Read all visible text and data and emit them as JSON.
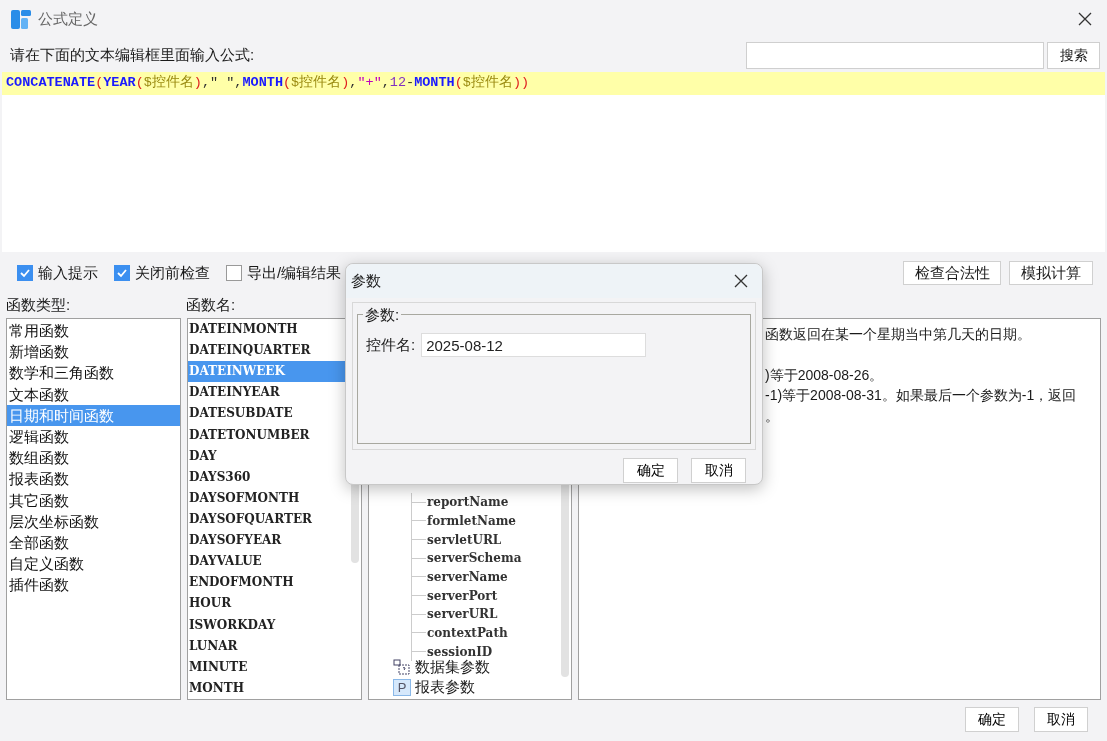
{
  "window": {
    "title": "公式定义"
  },
  "prompt": "请在下面的文本编辑框里面输入公式:",
  "search": {
    "button": "搜索"
  },
  "formula": [
    {
      "kind": "fn",
      "text": "CONCATENATE"
    },
    {
      "kind": "paren",
      "text": "("
    },
    {
      "kind": "fn",
      "text": "YEAR"
    },
    {
      "kind": "paren",
      "text": "("
    },
    {
      "kind": "param",
      "text": "$控件名"
    },
    {
      "kind": "paren",
      "text": ")"
    },
    {
      "kind": "plain",
      "text": ",\" \","
    },
    {
      "kind": "fn",
      "text": "MONTH"
    },
    {
      "kind": "paren",
      "text": "("
    },
    {
      "kind": "param",
      "text": "$控件名"
    },
    {
      "kind": "paren",
      "text": ")"
    },
    {
      "kind": "plain",
      "text": ","
    },
    {
      "kind": "string",
      "text": "\"+\""
    },
    {
      "kind": "plain",
      "text": ","
    },
    {
      "kind": "number",
      "text": "12"
    },
    {
      "kind": "plain",
      "text": "-"
    },
    {
      "kind": "fn",
      "text": "MONTH"
    },
    {
      "kind": "paren",
      "text": "("
    },
    {
      "kind": "param",
      "text": "$控件名"
    },
    {
      "kind": "paren",
      "text": "))"
    }
  ],
  "options": [
    {
      "label": "输入提示",
      "checked": true
    },
    {
      "label": "关闭前检查",
      "checked": true
    },
    {
      "label": "导出/编辑结果",
      "checked": false
    }
  ],
  "actions": [
    "检查合法性",
    "模拟计算"
  ],
  "types_label": "函数类型:",
  "types": [
    {
      "label": "常用函数",
      "selected": false
    },
    {
      "label": "新增函数",
      "selected": false
    },
    {
      "label": "数学和三角函数",
      "selected": false
    },
    {
      "label": "文本函数",
      "selected": false
    },
    {
      "label": "日期和时间函数",
      "selected": true
    },
    {
      "label": "逻辑函数",
      "selected": false
    },
    {
      "label": "数组函数",
      "selected": false
    },
    {
      "label": "报表函数",
      "selected": false
    },
    {
      "label": "其它函数",
      "selected": false
    },
    {
      "label": "层次坐标函数",
      "selected": false
    },
    {
      "label": "全部函数",
      "selected": false
    },
    {
      "label": "自定义函数",
      "selected": false
    },
    {
      "label": "插件函数",
      "selected": false
    }
  ],
  "names_label": "函数名:",
  "names": [
    {
      "label": "DATEINMONTH",
      "selected": false
    },
    {
      "label": "DATEINQUARTER",
      "selected": false
    },
    {
      "label": "DATEINWEEK",
      "selected": true
    },
    {
      "label": "DATEINYEAR",
      "selected": false
    },
    {
      "label": "DATESUBDATE",
      "selected": false
    },
    {
      "label": "DATETONUMBER",
      "selected": false
    },
    {
      "label": "DAY",
      "selected": false
    },
    {
      "label": "DAYS360",
      "selected": false
    },
    {
      "label": "DAYSOFMONTH",
      "selected": false
    },
    {
      "label": "DAYSOFQUARTER",
      "selected": false
    },
    {
      "label": "DAYSOFYEAR",
      "selected": false
    },
    {
      "label": "DAYVALUE",
      "selected": false
    },
    {
      "label": "ENDOFMONTH",
      "selected": false
    },
    {
      "label": "HOUR",
      "selected": false
    },
    {
      "label": "ISWORKDAY",
      "selected": false
    },
    {
      "label": "LUNAR",
      "selected": false
    },
    {
      "label": "MINUTE",
      "selected": false
    },
    {
      "label": "MONTH",
      "selected": false
    }
  ],
  "tree": {
    "leaves": [
      "reportName",
      "formletName",
      "servletURL",
      "serverSchema",
      "serverName",
      "serverPort",
      "serverURL",
      "contextPath",
      "sessionID"
    ],
    "nodes": [
      {
        "kind": "dataset",
        "label": "数据集参数"
      },
      {
        "kind": "report",
        "label": "报表参数",
        "icon_text": "P"
      }
    ]
  },
  "description": [
    [
      "函数返回在某一个星期当中第几天的日期。"
    ],
    [
      ")等于2008-08-26。",
      "-1)等于2008-08-31。如果最后一个参数为-1，返回",
      "。"
    ]
  ],
  "buttons": [
    "确定",
    "取消"
  ],
  "dialog": {
    "title": "参数",
    "group": "参数:",
    "field_label": "控件名:",
    "field_value": "2025-08-12",
    "buttons": [
      "确定",
      "取消"
    ]
  }
}
